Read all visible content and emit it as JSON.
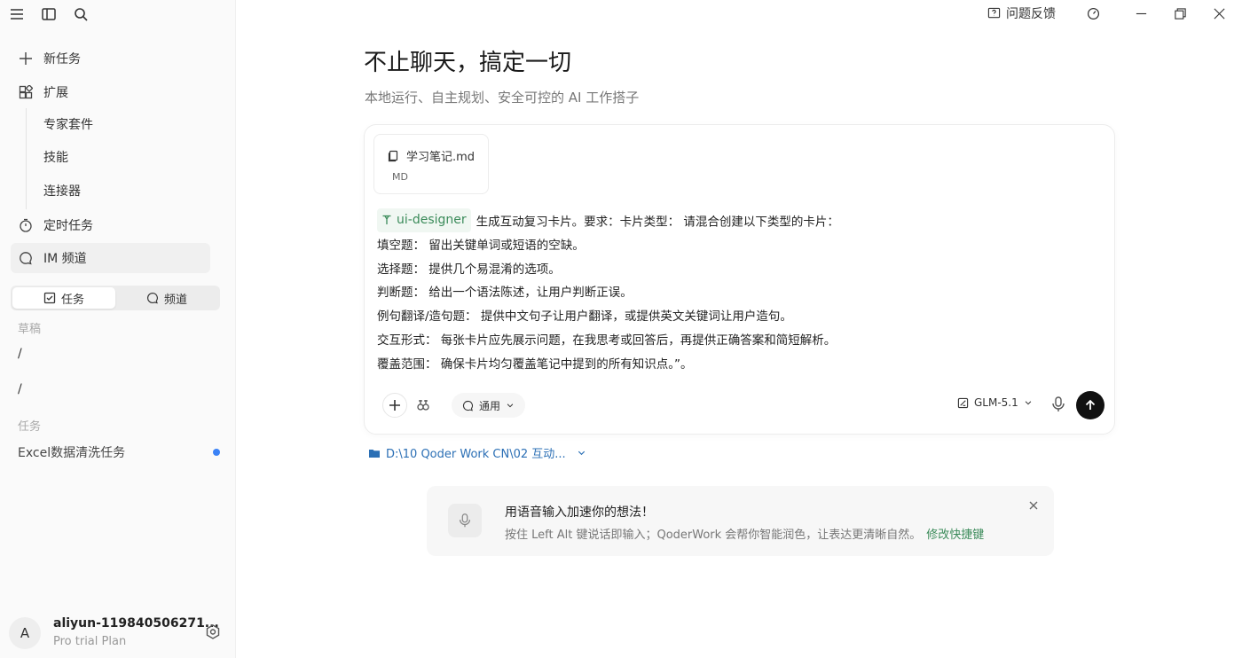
{
  "sidebar": {
    "nav": [
      {
        "label": "新任务",
        "icon": "plus-icon"
      },
      {
        "label": "扩展",
        "icon": "extension-icon"
      },
      {
        "label": "定时任务",
        "icon": "timer-icon"
      },
      {
        "label": "IM 频道",
        "icon": "chat-icon"
      }
    ],
    "extension_sub": [
      "专家套件",
      "技能",
      "连接器"
    ],
    "segments": [
      {
        "label": "任务",
        "icon": "checkbox-icon"
      },
      {
        "label": "频道",
        "icon": "chat-icon"
      }
    ],
    "drafts_label": "草稿",
    "drafts": [
      "/",
      "/"
    ],
    "tasks_label": "任务",
    "tasks": [
      {
        "label": "Excel数据清洗任务"
      }
    ]
  },
  "user": {
    "avatar_letter": "A",
    "name": "aliyun-119840506271...",
    "plan": "Pro trial Plan"
  },
  "topbar": {
    "feedback_label": "问题反馈"
  },
  "hero": {
    "title": "不止聊天，搞定一切",
    "subtitle": "本地运行、自主规划、安全可控的 AI 工作搭子"
  },
  "composer": {
    "attachment": {
      "name": "学习笔记.md",
      "type": "MD"
    },
    "skill_chip": "ui-designer",
    "lines": [
      "生成互动复习卡片。要求：卡片类型： 请混合创建以下类型的卡片：",
      "填空题： 留出关键单词或短语的空缺。",
      "选择题： 提供几个易混淆的选项。",
      "判断题： 给出一个语法陈述，让用户判断正误。",
      "例句翻译/造句题： 提供中文句子让用户翻译，或提供英文关键词让用户造句。",
      "交互形式： 每张卡片应先展示问题，在我思考或回答后，再提供正确答案和简短解析。",
      "覆盖范围： 确保卡片均匀覆盖笔记中提到的所有知识点。”。"
    ],
    "mode_label": "通用",
    "model_label": "GLM-5.1"
  },
  "workspace_path": "D:\\10 Qoder Work CN\\02 互动...",
  "tip": {
    "title": "用语音输入加速你的想法！",
    "body": "按住 Left Alt 键说话即输入；QoderWork 会帮你智能润色，让表达更清晰自然。",
    "link": "修改快捷键"
  },
  "colors": {
    "accent_green": "#3b8b5a",
    "link_blue": "#2b6fb5",
    "unread_dot": "#3b82f6"
  }
}
